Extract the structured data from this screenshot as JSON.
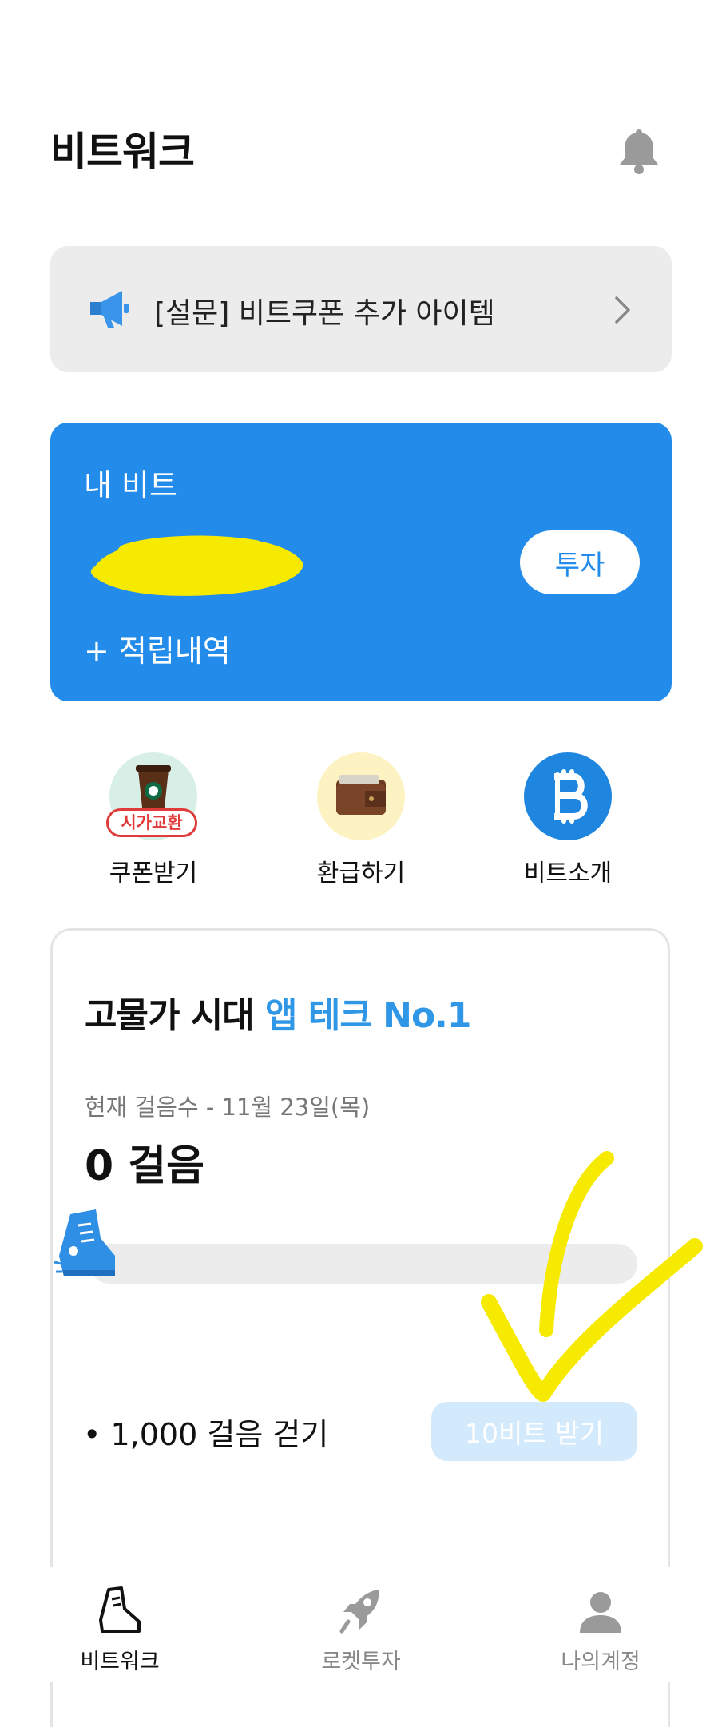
{
  "header": {
    "title": "비트워크"
  },
  "banner": {
    "text": "[설문] 비트쿠폰 추가 아이템"
  },
  "bit_card": {
    "label": "내 비트",
    "invest_button": "투자",
    "history_link": "+ 적립내역"
  },
  "shortcuts": [
    {
      "label": "쿠폰받기",
      "badge": "시가교환",
      "icon": "coffee-cup-icon"
    },
    {
      "label": "환급하기",
      "icon": "wallet-icon"
    },
    {
      "label": "비트소개",
      "icon": "bitcoin-icon"
    }
  ],
  "walk": {
    "heading_prefix": "고물가 시대",
    "heading_accent": "앱 테크 No.1",
    "date_text": "현재 걸음수 - 11월 23일(목)",
    "steps_text": "0 걸음",
    "task_text": "• 1,000 걸음 걷기",
    "claim_button": "10비트 받기"
  },
  "nav": [
    {
      "label": "비트워크",
      "icon": "sneaker-icon",
      "active": true
    },
    {
      "label": "로켓투자",
      "icon": "rocket-icon",
      "active": false
    },
    {
      "label": "나의계정",
      "icon": "person-icon",
      "active": false
    }
  ],
  "colors": {
    "primary_blue": "#238cea",
    "accent_text": "#2f97e6",
    "claim_disabled": "#d3eafd",
    "banner_bg": "#ececec",
    "scribble_yellow": "#f6ea00"
  }
}
